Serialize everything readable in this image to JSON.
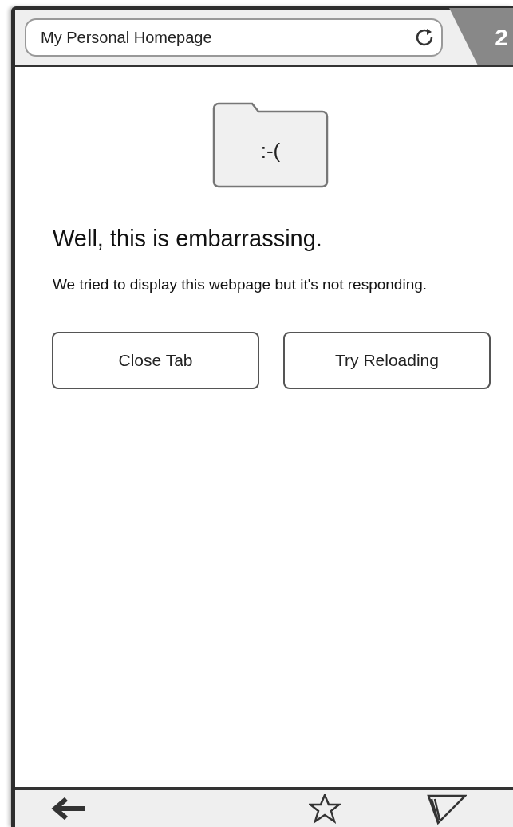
{
  "address_bar": {
    "title": "My Personal Homepage"
  },
  "tab_count": "2",
  "error": {
    "face": ":-(",
    "heading": "Well, this is embarrassing.",
    "message": "We tried to display this webpage but it's not responding."
  },
  "buttons": [
    "Close Tab",
    "Try Reloading"
  ]
}
